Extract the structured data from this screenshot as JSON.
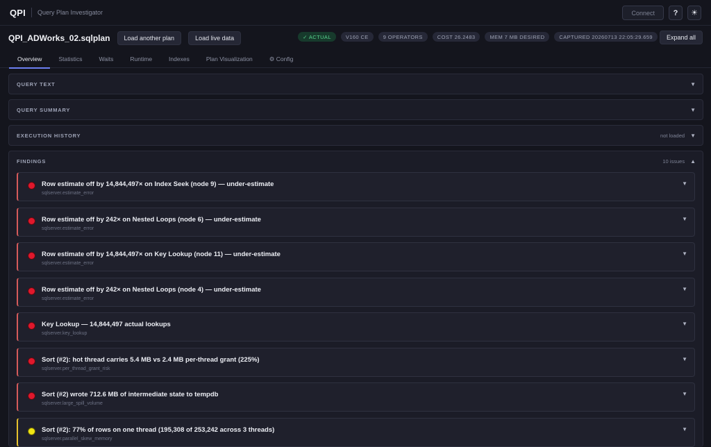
{
  "app": {
    "brand": "QPI",
    "subtitle": "Query Plan Investigator",
    "connect_label": "Connect",
    "help_label": "?",
    "theme_icon": "☀"
  },
  "filebar": {
    "filename": "QPI_ADWorks_02.sqlplan",
    "load_another_label": "Load another plan",
    "load_live_label": "Load live data",
    "badges": {
      "actual": "✓ ACTUAL",
      "version": "V160 CE",
      "operators": "9 OPERATORS",
      "cost": "COST 26.2483",
      "mem": "MEM 7 MB DESIRED",
      "captured": "CAPTURED 20260713 22:05:29.659"
    },
    "expand_all_label": "Expand all"
  },
  "tabs": [
    {
      "label": "Overview"
    },
    {
      "label": "Statistics"
    },
    {
      "label": "Waits"
    },
    {
      "label": "Runtime"
    },
    {
      "label": "Indexes"
    },
    {
      "label": "Plan Visualization"
    },
    {
      "label": "⚙ Config"
    }
  ],
  "panels": {
    "query_text": {
      "title": "QUERY TEXT",
      "chevron": "▼"
    },
    "query_summary": {
      "title": "QUERY SUMMARY",
      "chevron": "▼"
    },
    "execution_history": {
      "title": "EXECUTION HISTORY",
      "note": "not loaded",
      "chevron": "▼"
    },
    "findings": {
      "title": "FINDINGS",
      "note": "10 issues",
      "chevron": "▲"
    }
  },
  "findings": [
    {
      "title": "Row estimate off by 14,844,497× on Index Seek (node 9) — under-estimate",
      "rule": "sqlserver.estimate_error",
      "severity": "error"
    },
    {
      "title": "Row estimate off by 242× on Nested Loops (node 6) — under-estimate",
      "rule": "sqlserver.estimate_error",
      "severity": "error"
    },
    {
      "title": "Row estimate off by 14,844,497× on Key Lookup (node 11) — under-estimate",
      "rule": "sqlserver.estimate_error",
      "severity": "error"
    },
    {
      "title": "Row estimate off by 242× on Nested Loops (node 4) — under-estimate",
      "rule": "sqlserver.estimate_error",
      "severity": "error"
    },
    {
      "title": "Key Lookup — 14,844,497 actual lookups",
      "rule": "sqlserver.key_lookup",
      "severity": "error"
    },
    {
      "title": "Sort (#2): hot thread carries 5.4 MB vs 2.4 MB per-thread grant (225%)",
      "rule": "sqlserver.per_thread_grant_risk",
      "severity": "error"
    },
    {
      "title": "Sort (#2) wrote 712.6 MB of intermediate state to tempdb",
      "rule": "sqlserver.large_spill_volume",
      "severity": "error"
    },
    {
      "title": "Sort (#2): 77% of rows on one thread (195,308 of 253,242 across 3 threads)",
      "rule": "sqlserver.parallel_skew_memory",
      "severity": "warning"
    }
  ],
  "finding_chevron": "▼",
  "colors": {
    "background": "#14151d",
    "accent": "#6c7ff2",
    "error": "#e0182c",
    "warning": "#f0e513",
    "actual_badge": "#57d48e"
  }
}
